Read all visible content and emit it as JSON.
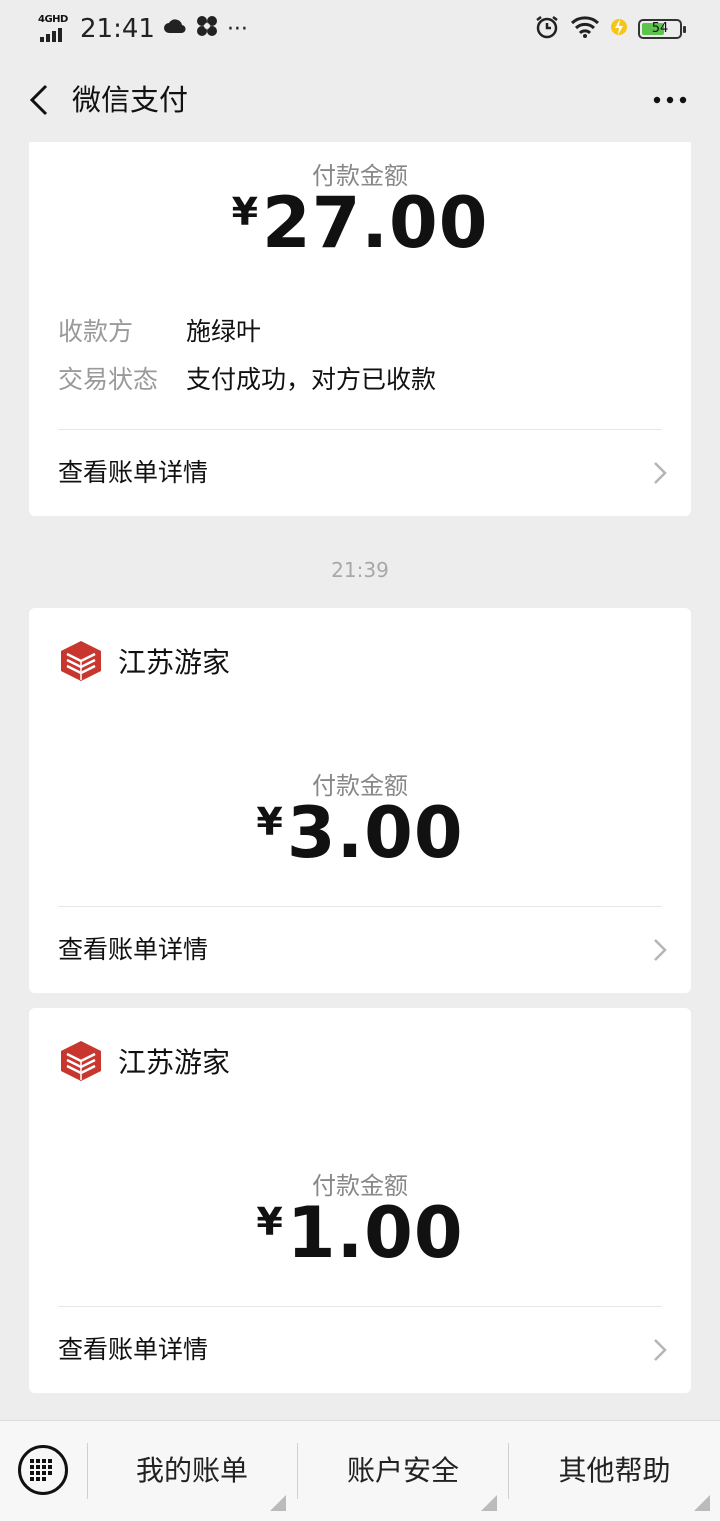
{
  "status_bar": {
    "network": "4GHD",
    "time": "21:41",
    "more": "···",
    "battery": "54"
  },
  "nav": {
    "title": "微信支付"
  },
  "cards": [
    {
      "amount_label": "付款金额",
      "currency": "¥",
      "amount": "27.00",
      "fields": [
        {
          "key": "收款方",
          "value": "施绿叶"
        },
        {
          "key": "交易状态",
          "value": "支付成功，对方已收款"
        }
      ],
      "detail_link": "查看账单详情"
    },
    {
      "merchant": "江苏游家",
      "amount_label": "付款金额",
      "currency": "¥",
      "amount": "3.00",
      "detail_link": "查看账单详情"
    },
    {
      "merchant": "江苏游家",
      "amount_label": "付款金额",
      "currency": "¥",
      "amount": "1.00",
      "detail_link": "查看账单详情"
    }
  ],
  "timestamp": "21:39",
  "bottom_menu": {
    "items": [
      "我的账单",
      "账户安全",
      "其他帮助"
    ]
  },
  "colors": {
    "background": "#ededed",
    "card": "#ffffff",
    "battery_fill": "#5ec34e",
    "logo": "#c8372d"
  }
}
